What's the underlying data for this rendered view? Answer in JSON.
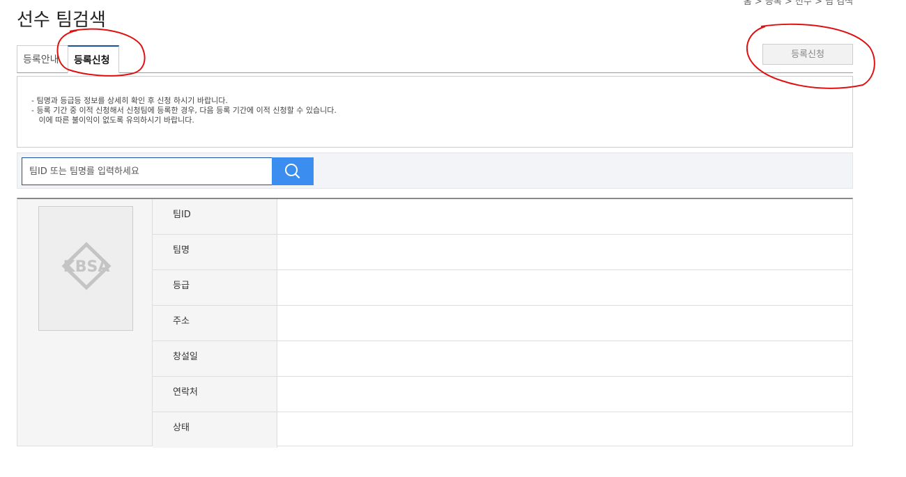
{
  "breadcrumb": "홈 > 등록 > 선수 > 팀 검색",
  "page_title": "선수 팀검색",
  "tabs": [
    {
      "label": "등록안내",
      "active": false
    },
    {
      "label": "등록신청",
      "active": true
    }
  ],
  "register_button": {
    "label": "등록신청"
  },
  "notice": {
    "lines": [
      "- 팀명과 등급등 정보를 상세히 확인 후 신청 하시기 바랍니다.",
      "- 등록 기간 중 이적 신청해서 신청팀에 등록한 경우, 다음 등록 기간에 이적 신청할 수 있습니다.",
      "   이에 따른 불이익이 없도록 유의하시기 바랍니다."
    ]
  },
  "search": {
    "placeholder": "팀ID 또는 팀명를 입력하세요",
    "button_icon": "search-icon"
  },
  "team_info": {
    "logo_text": "KBSA",
    "rows": [
      {
        "label": "팀ID",
        "value": ""
      },
      {
        "label": "팀명",
        "value": ""
      },
      {
        "label": "등급",
        "value": ""
      },
      {
        "label": "주소",
        "value": ""
      },
      {
        "label": "창설일",
        "value": ""
      },
      {
        "label": "연락처",
        "value": ""
      },
      {
        "label": "상태",
        "value": ""
      }
    ]
  },
  "colors": {
    "accent": "#1a4fa0",
    "search_button": "#3b8ef0",
    "annotation": "#e01010"
  }
}
